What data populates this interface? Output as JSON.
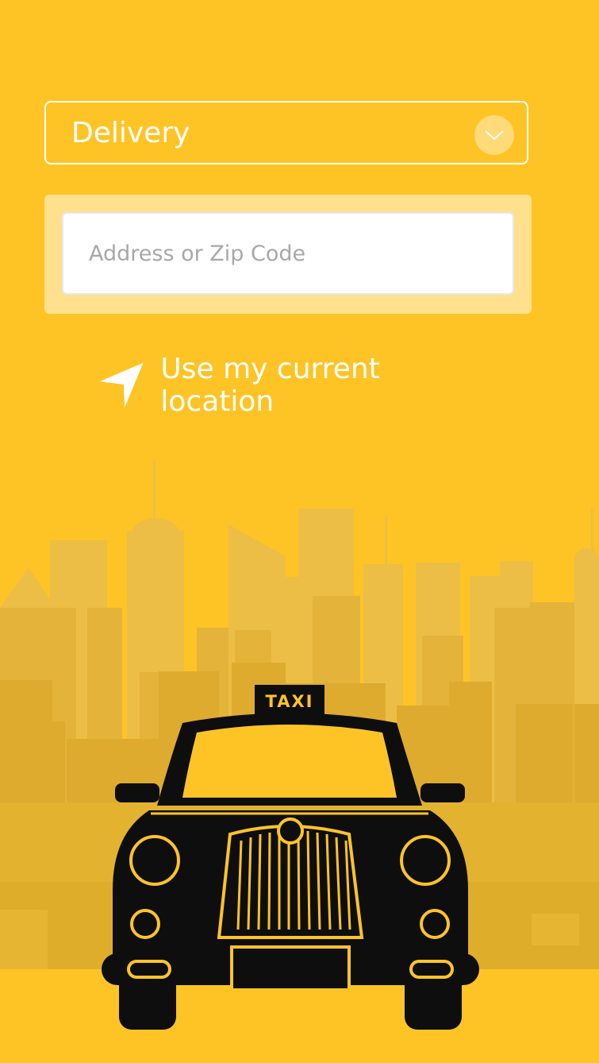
{
  "delivery_select": {
    "selected_label": "Delivery",
    "toggle_icon": "chevron-down-icon"
  },
  "address": {
    "placeholder": "Address or Zip Code",
    "value": ""
  },
  "current_location": {
    "label": "Use my current location",
    "icon": "location-arrow-icon"
  },
  "illustration": {
    "sign_text": "TAXI"
  },
  "colors": {
    "background": "#FEC426",
    "field_frame": "#FEE08D",
    "taxi_body": "#0E0E0E",
    "accent_line": "#FEC426",
    "white": "#FFFFFF"
  }
}
